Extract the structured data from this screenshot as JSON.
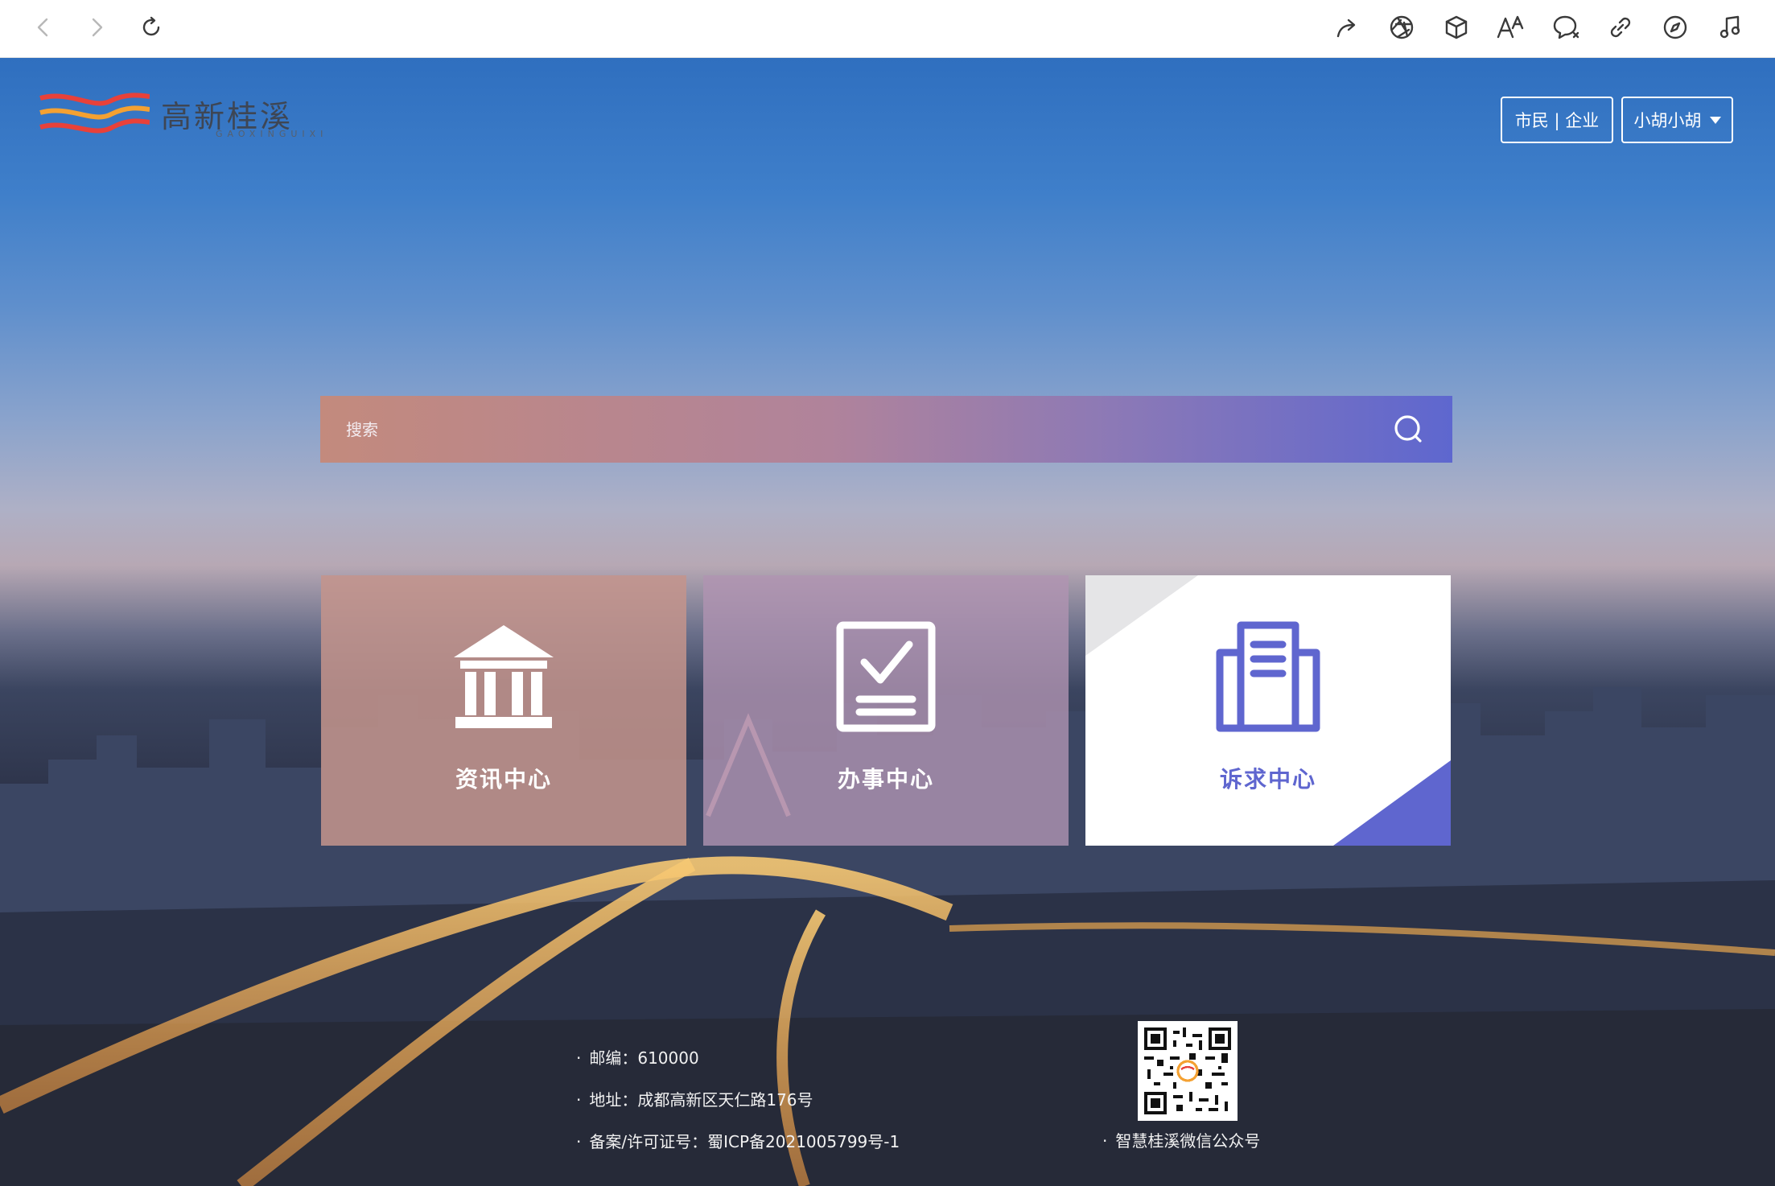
{
  "browser": {
    "back_icon": "chevron-left-icon",
    "forward_icon": "chevron-right-icon",
    "reload_icon": "reload-icon",
    "toolbar_icons": [
      "share-icon",
      "aperture-icon",
      "cube-icon",
      "text-size-icon",
      "chat-icon",
      "link-icon",
      "compass-icon",
      "music-note-icon"
    ]
  },
  "header": {
    "logo_text": "高新桂溪",
    "logo_sub": "GAOXINGUIXI",
    "role_switch": "市民 | 企业",
    "user_menu": "小胡小胡"
  },
  "search": {
    "placeholder": "搜索"
  },
  "cards": [
    {
      "label": "资讯中心",
      "icon": "bank-icon"
    },
    {
      "label": "办事中心",
      "icon": "checklist-icon"
    },
    {
      "label": "诉求中心",
      "icon": "building-icon",
      "active": true
    }
  ],
  "footer": {
    "postcode": "邮编：610000",
    "address": "地址：成都高新区天仁路176号",
    "license": "备案/许可证号：蜀ICP备2021005799号-1",
    "qr_caption": "智慧桂溪微信公众号"
  },
  "colors": {
    "accent": "#5f66cf",
    "search_start": "#c38a7d",
    "search_end": "#5e67cf",
    "logo_red": "#e8413a",
    "logo_orange": "#f4a132"
  }
}
